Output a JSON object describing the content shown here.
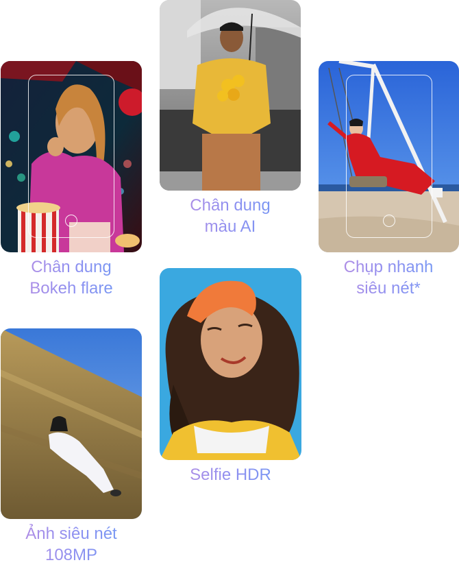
{
  "photos": [
    {
      "line1": "Chân dung",
      "line2": "Bokeh flare"
    },
    {
      "line1": "Chân dung",
      "line2": "màu AI"
    },
    {
      "line1": "Chụp nhanh",
      "line2": "siêu nét*"
    },
    {
      "line1": "Ảnh siêu nét",
      "line2": "108MP"
    },
    {
      "line1": "Selfie HDR",
      "line2": ""
    }
  ]
}
